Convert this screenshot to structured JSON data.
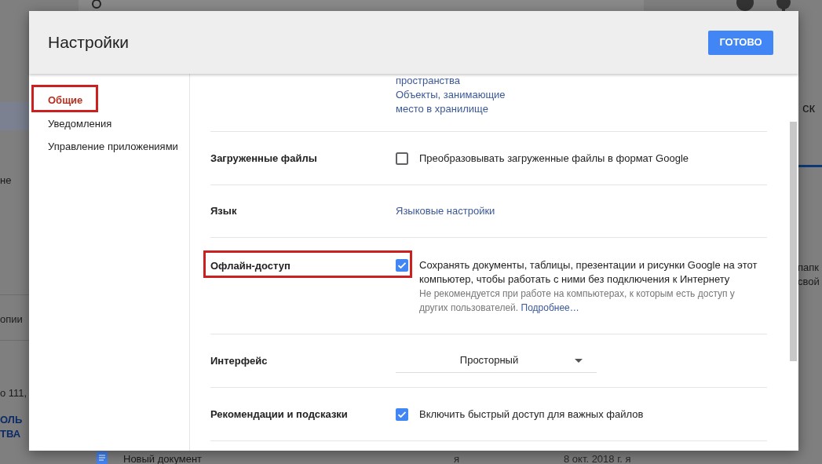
{
  "background": {
    "left_texts": [
      "не",
      "опии",
      "о 111,"
    ],
    "left_link_lines": [
      "ОЛЬ",
      "ТВА"
    ],
    "right_texts": [
      "ск",
      "папк",
      "свой"
    ],
    "file_row": {
      "name": "Новый документ",
      "owner": "я",
      "modified": "8 окт. 2018 г. я"
    }
  },
  "dialog": {
    "title": "Настройки",
    "done_button": "ГОТОВО",
    "nav": [
      {
        "label": "Общие",
        "selected": true,
        "highlighted": true
      },
      {
        "label": "Уведомления",
        "selected": false,
        "highlighted": false
      },
      {
        "label": "Управление приложениями",
        "selected": false,
        "highlighted": false
      }
    ],
    "rows": [
      {
        "kind": "links",
        "links": [
          "пространства",
          "Объекты, занимающие место в хранилище"
        ]
      },
      {
        "kind": "checkbox",
        "label": "Загруженные файлы",
        "checked": false,
        "highlighted": false,
        "text": "Преобразовывать загруженные файлы в формат Google"
      },
      {
        "kind": "link",
        "label": "Язык",
        "link": "Языковые настройки"
      },
      {
        "kind": "checkbox",
        "label": "Офлайн-доступ",
        "checked": true,
        "highlighted": true,
        "text": "Сохранять документы, таблицы, презентации и рисунки Google на этот компьютер, чтобы работать с ними без подключения к Интернету",
        "hint": "Не рекомендуется при работе на компьютерах, к которым есть доступ у других пользователей.",
        "hint_link": "Подробнее…"
      },
      {
        "kind": "select",
        "label": "Интерфейс",
        "value": "Просторный"
      },
      {
        "kind": "checkbox",
        "label": "Рекомендации и подсказки",
        "checked": true,
        "highlighted": false,
        "text": "Включить быстрый доступ для важных файлов"
      }
    ]
  }
}
